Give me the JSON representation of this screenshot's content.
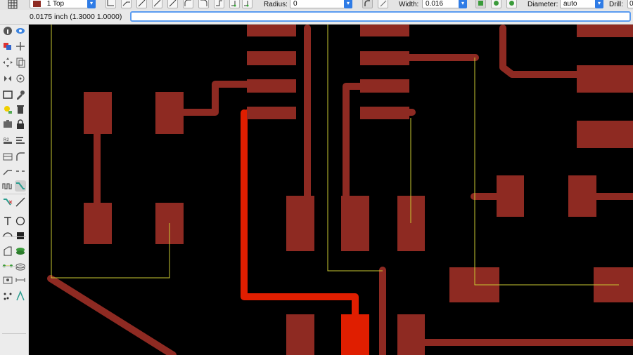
{
  "toolbar": {
    "layer_selected": "1 Top",
    "radius_label": "Radius:",
    "radius_value": "0",
    "width_label": "Width:",
    "width_value": "0.016",
    "diameter_label": "Diameter:",
    "diameter_value": "auto",
    "drill_label": "Drill:",
    "drill_value": "0"
  },
  "coord_display": "0.0175 inch (1.3000 1.0000)",
  "command_line": {
    "value": "",
    "placeholder": ""
  },
  "sidebar": {
    "tools": [
      "info-icon",
      "show-icon",
      "display-layers-icon",
      "mark-icon",
      "move-icon",
      "copy-icon",
      "mirror-icon",
      "rotate-icon",
      "group-icon",
      "change-icon",
      "paste-icon",
      "delete-icon",
      "add-icon",
      "lock-icon",
      "name-icon",
      "value-icon",
      "smash-icon",
      "miter-icon",
      "split-icon",
      "optimize-icon",
      "meander-icon",
      "route-icon",
      "ripup-icon",
      "wire-icon",
      "text-icon",
      "circle-icon",
      "arc-icon",
      "rect-icon",
      "polygon-icon",
      "via-icon",
      "signal-icon",
      "hole-icon",
      "attribute-icon",
      "dimension-icon",
      "ratsnest-icon",
      "autorouter-icon"
    ]
  },
  "colors": {
    "trace": "#8e2a22",
    "trace_highlight": "#e01e00",
    "airwire": "#c8c832",
    "background": "#000000"
  }
}
